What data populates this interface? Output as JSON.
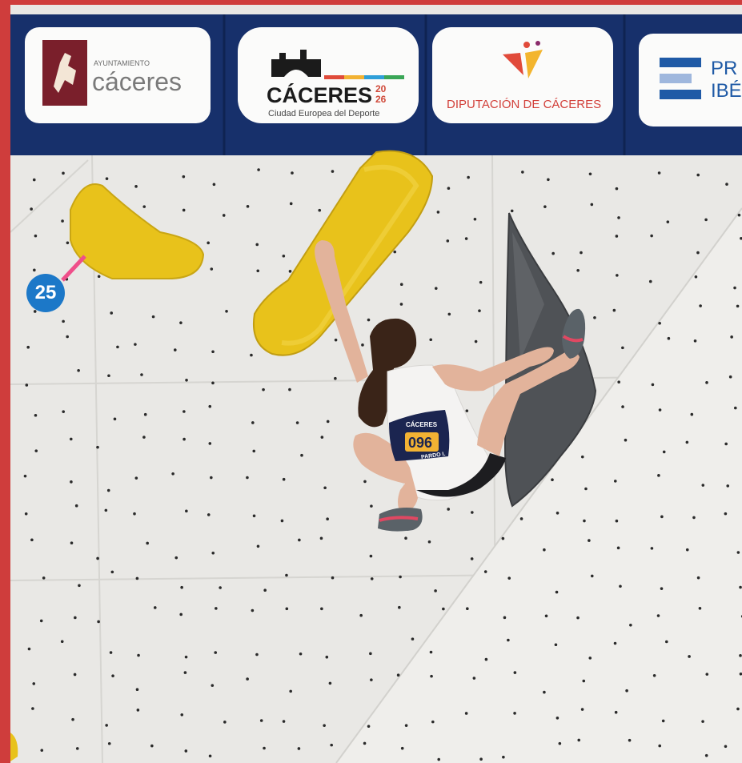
{
  "banner": {
    "sponsor_1": {
      "small": "AYUNTAMIENTO",
      "large": "cáceres"
    },
    "sponsor_2": {
      "large": "CÁCERES",
      "year_top": "20",
      "year_bottom": "26",
      "tagline": "Ciudad Europea del Deporte"
    },
    "sponsor_3": {
      "large": "DIPUTACIÓN DE CÁCERES"
    },
    "sponsor_4": {
      "line1": "PR",
      "line2": "IBÉ"
    }
  },
  "route_number": "25",
  "bib": {
    "event": "CÁCERES",
    "number": "096",
    "footer": "PARDO I."
  },
  "colors": {
    "banner_navy": "#17306b",
    "hold_yellow": "#e8c21b",
    "badge_blue": "#1c78c8",
    "frame_red": "#cf3d3c"
  }
}
